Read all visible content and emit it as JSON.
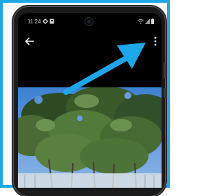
{
  "status_bar": {
    "time": "11:24",
    "left_icons": [
      "gear-icon",
      "photo-icon"
    ],
    "right_icons": [
      "wifi-icon",
      "signal-icon",
      "battery-icon"
    ]
  },
  "toolbar": {
    "back_icon": "arrow-left-icon",
    "more_icon": "more-vertical-icon"
  },
  "annotation": {
    "arrow_color": "#1ea7e8",
    "frame_color": "#1ea7e8"
  },
  "photo": {
    "subject": "tree-canopy",
    "sky_color": "#4d8fd9"
  }
}
